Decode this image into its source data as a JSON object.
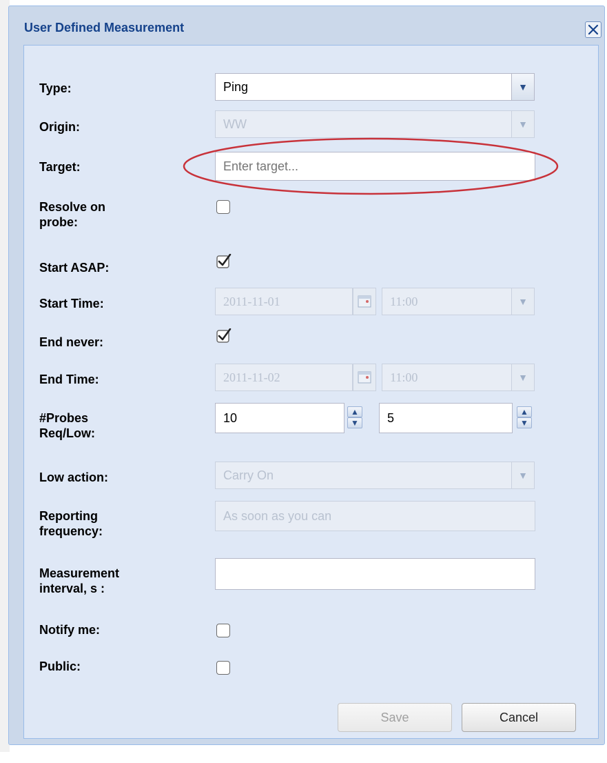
{
  "dialog": {
    "title": "User Defined Measurement"
  },
  "form": {
    "type": {
      "label": "Type:",
      "value": "Ping"
    },
    "origin": {
      "label": "Origin:",
      "value": "WW"
    },
    "target": {
      "label": "Target:",
      "placeholder": "Enter target..."
    },
    "resolve_on_probe": {
      "label_line1": "Resolve on",
      "label_line2": "probe:",
      "checked": false
    },
    "start_asap": {
      "label": "Start ASAP:",
      "checked": true
    },
    "start_time": {
      "label": "Start Time:",
      "date": "2011-11-01",
      "time": "11:00"
    },
    "end_never": {
      "label": "End never:",
      "checked": true
    },
    "end_time": {
      "label": "End Time:",
      "date": "2011-11-02",
      "time": "11:00"
    },
    "probes": {
      "label_line1": "#Probes",
      "label_line2": "Req/Low:",
      "requested": "10",
      "low": "5"
    },
    "low_action": {
      "label": "Low action:",
      "value": "Carry On"
    },
    "reporting_frequency": {
      "label_line1": "Reporting",
      "label_line2": "frequency:",
      "value": "As soon as you can"
    },
    "measurement_interval": {
      "label_line1": "Measurement",
      "label_line2": "interval, s :",
      "value": ""
    },
    "notify_me": {
      "label": "Notify me:",
      "checked": false
    },
    "public": {
      "label": "Public:",
      "checked": false
    }
  },
  "buttons": {
    "save": "Save",
    "cancel": "Cancel"
  },
  "colors": {
    "title": "#15428b",
    "highlight": "#c8323a"
  }
}
